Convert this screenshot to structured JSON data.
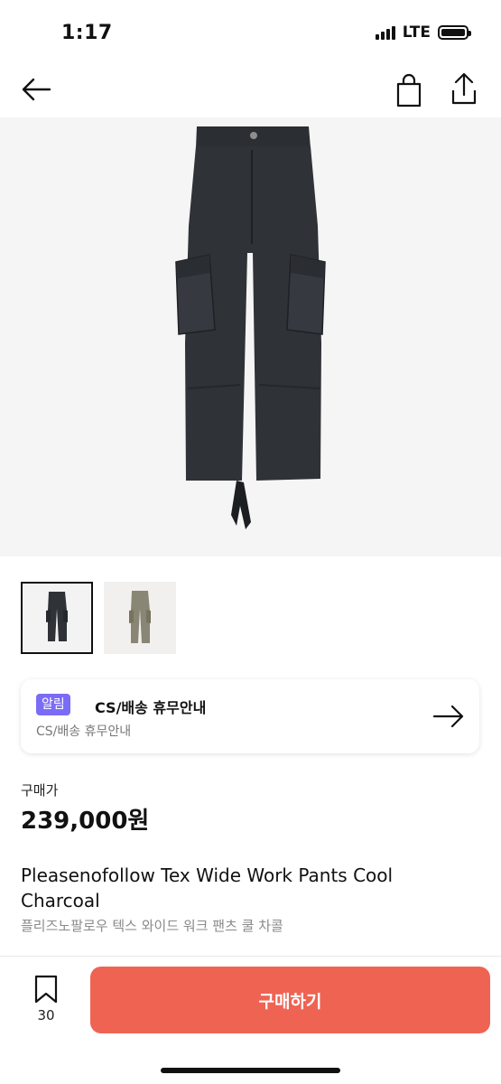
{
  "status_bar": {
    "time": "1:17",
    "network": "LTE"
  },
  "nav": {
    "back_icon": "arrow-left-icon",
    "bag_icon": "shopping-bag-icon",
    "share_icon": "share-icon"
  },
  "product_image": {
    "subject": "black-cargo-pants"
  },
  "thumbnails": [
    {
      "variant": "charcoal",
      "selected": true
    },
    {
      "variant": "khaki",
      "selected": false
    }
  ],
  "notice": {
    "badge": "알림",
    "title": "CS/배송 휴무안내",
    "subtitle": "CS/배송 휴무안내",
    "arrow_icon": "arrow-right-icon"
  },
  "price": {
    "label": "구매가",
    "value": "239,000원"
  },
  "product": {
    "title_en": "Pleasenofollow Tex Wide Work Pants Cool Charcoal",
    "title_kr": "플리즈노팔로우 텍스 와이드 워크 팬츠 쿨 차콜"
  },
  "bottom_bar": {
    "bookmark_count": "30",
    "buy_label": "구매하기"
  },
  "colors": {
    "accent": "#ef6353",
    "badge": "#7b6cf6"
  }
}
